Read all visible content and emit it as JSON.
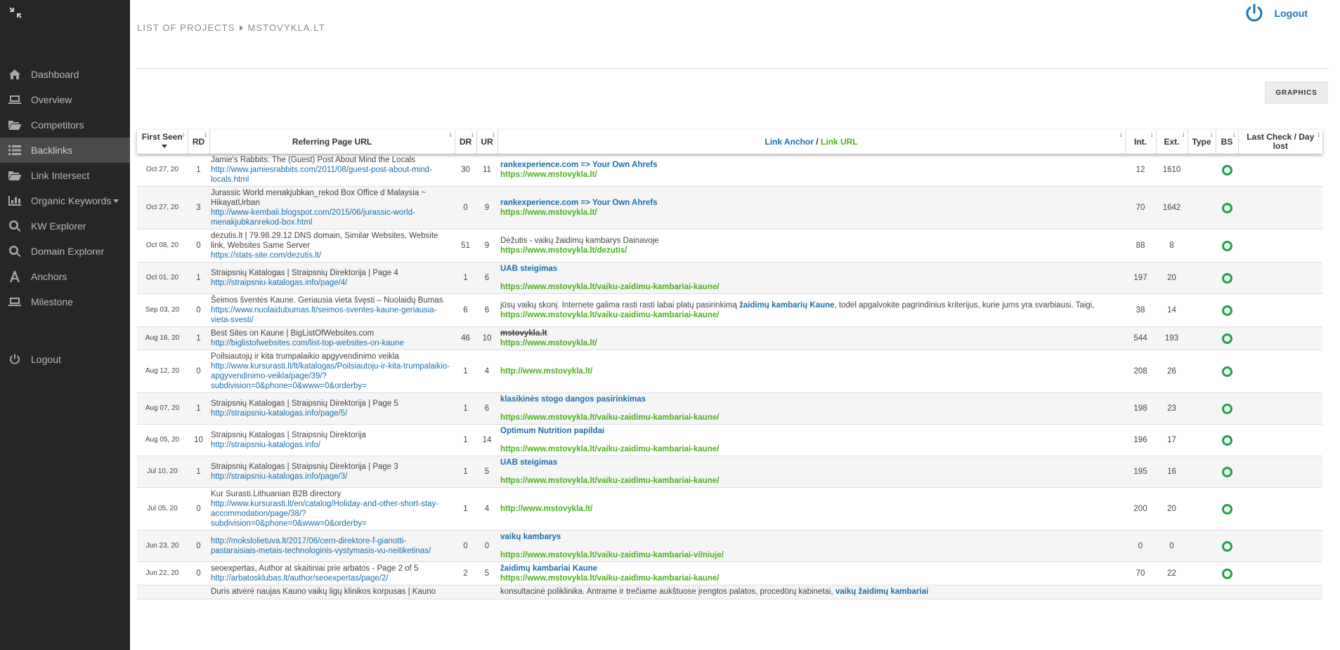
{
  "sidebar": {
    "items": [
      {
        "label": "Dashboard",
        "icon": "home-icon"
      },
      {
        "label": "Overview",
        "icon": "laptop-icon"
      },
      {
        "label": "Competitors",
        "icon": "folder-open-icon"
      },
      {
        "label": "Backlinks",
        "icon": "list-icon",
        "active": true
      },
      {
        "label": "Link Intersect",
        "icon": "folder-open-icon"
      },
      {
        "label": "Organic Keywords",
        "icon": "bar-chart-icon",
        "dropdown": true
      },
      {
        "label": "KW Explorer",
        "icon": "search-icon"
      },
      {
        "label": "Domain Explorer",
        "icon": "search-icon"
      },
      {
        "label": "Anchors",
        "icon": "font-icon"
      },
      {
        "label": "Milestone",
        "icon": "laptop-icon"
      }
    ],
    "logout_label": "Logout"
  },
  "header": {
    "breadcrumb_root": "LIST OF PROJECTS",
    "breadcrumb_current": "MSTOVYKLA.LT",
    "logout_label": "Logout",
    "graphics_label": "GRAPHICS"
  },
  "table": {
    "headers": {
      "first_seen": "First Seen",
      "rd": "RD",
      "ref_url": "Referring Page URL",
      "dr": "DR",
      "ur": "UR",
      "anchor": "Link Anchor",
      "slash": " / ",
      "link_url": "Link URL",
      "int": "Int.",
      "ext": "Ext.",
      "type": "Type",
      "bs": "BS",
      "last_check": "Last Check / Day lost",
      "info": "i"
    },
    "rows": [
      {
        "date": "Oct 27, 20",
        "rd": "1",
        "title": "Jamie's Rabbits: The (Guest) Post About Mind the Locals",
        "url": "http://www.jamiesrabbits.com/2011/08/guest-post-about-mind-locals.html",
        "dr": "30",
        "ur": "11",
        "anchor": "rankexperience.com => Your Own Ahrefs",
        "pre": "",
        "post": "",
        "strike": false,
        "gap": false,
        "link": "https://www.mstovykla.lt/",
        "int": "12",
        "ext": "1610"
      },
      {
        "date": "Oct 27, 20",
        "rd": "3",
        "title": "Jurassic World menakjubkan_rekod Box Office d Malaysia ~ HikayatUrban",
        "url": "http://www-kembali.blogspot.com/2015/06/jurassic-world-menakjubkanrekod-box.html",
        "dr": "0",
        "ur": "9",
        "anchor": "rankexperience.com => Your Own Ahrefs",
        "pre": "",
        "post": "",
        "strike": false,
        "gap": false,
        "link": "https://www.mstovykla.lt/",
        "int": "70",
        "ext": "1642"
      },
      {
        "date": "Oct 08, 20",
        "rd": "0",
        "title": "dezutis.lt | 79.98.29.12 DNS domain, Similar Websites, Website link, Websites Same Server",
        "url": "https://stats-site.com/dezutis.lt/",
        "dr": "51",
        "ur": "9",
        "anchor": "",
        "pre": "Dėžutis - vaikų žaidimų kambarys Dainavoje",
        "post": "",
        "strike": false,
        "gap": false,
        "link": "https://www.mstovykla.lt/dezutis/",
        "int": "88",
        "ext": "8"
      },
      {
        "date": "Oct 01, 20",
        "rd": "1",
        "title": "Straipsnių Katalogas | Straipsnių Direktorija | Page 4",
        "url": "http://straipsniu-katalogas.info/page/4/",
        "dr": "1",
        "ur": "6",
        "anchor": "UAB steigimas",
        "pre": "",
        "post": "",
        "strike": false,
        "gap": true,
        "link": "https://www.mstovykla.lt/vaiku-zaidimu-kambariai-kaune/",
        "int": "197",
        "ext": "20"
      },
      {
        "date": "Sep 03, 20",
        "rd": "0",
        "title": "Šeimos šventės Kaune. Geriausia vieta švęsti – Nuolaidų Bumas",
        "url": "https://www.nuolaidubumas.lt/seimos-sventes-kaune-geriausia-vieta-svesti/",
        "dr": "6",
        "ur": "6",
        "anchor": "žaidimų kambarių Kaune",
        "pre": "jūsų vaikų skonį. Internete galima rasti rasti labai platų pasirinkimą ",
        "post": ", todėl apgalvokite pagrindinius kriterijus, kurie jums yra svarbiausi. Taigi,",
        "strike": false,
        "gap": false,
        "link": "https://www.mstovykla.lt/vaiku-zaidimu-kambariai-kaune/",
        "int": "38",
        "ext": "14"
      },
      {
        "date": "Aug 16, 20",
        "rd": "1",
        "title": "Best Sites on Kaune | BigListOfWebsites.com",
        "url": "http://biglistofwebsites.com/list-top-websites-on-kaune",
        "dr": "46",
        "ur": "10",
        "anchor": "mstovykla.lt",
        "pre": "",
        "post": "",
        "strike": true,
        "gap": false,
        "link": "https://www.mstovykla.lt/",
        "int": "544",
        "ext": "193"
      },
      {
        "date": "Aug 12, 20",
        "rd": "0",
        "title": "Poilsiautojų ir kita trumpalaikio apgyvendinimo veikla",
        "url": "http://www.kursurasti.lt/lt/katalogas/Poilsiautoju-ir-kita-trumpalaikio-apgyvendinimo-veikla/page/39/?subdivision=0&phone=0&www=0&orderby=",
        "dr": "1",
        "ur": "4",
        "anchor": "",
        "pre": "",
        "post": "",
        "strike": false,
        "gap": false,
        "link": "http://www.mstovykla.lt/",
        "int": "208",
        "ext": "26"
      },
      {
        "date": "Aug 07, 20",
        "rd": "1",
        "title": "Straipsnių Katalogas | Straipsnių Direktorija | Page 5",
        "url": "http://straipsniu-katalogas.info/page/5/",
        "dr": "1",
        "ur": "6",
        "anchor": "klasikinės stogo dangos pasirinkimas",
        "pre": "",
        "post": "",
        "strike": false,
        "gap": true,
        "link": "https://www.mstovykla.lt/vaiku-zaidimu-kambariai-kaune/",
        "int": "198",
        "ext": "23"
      },
      {
        "date": "Aug 05, 20",
        "rd": "10",
        "title": "Straipsnių Katalogas | Straipsnių Direktorija",
        "url": "http://straipsniu-katalogas.info/",
        "dr": "1",
        "ur": "14",
        "anchor": "Optimum Nutrition papildai",
        "pre": "",
        "post": "",
        "strike": false,
        "gap": true,
        "link": "https://www.mstovykla.lt/vaiku-zaidimu-kambariai-kaune/",
        "int": "196",
        "ext": "17"
      },
      {
        "date": "Jul 10, 20",
        "rd": "1",
        "title": "Straipsnių Katalogas | Straipsnių Direktorija | Page 3",
        "url": "http://straipsniu-katalogas.info/page/3/",
        "dr": "1",
        "ur": "5",
        "anchor": "UAB steigimas",
        "pre": "",
        "post": "",
        "strike": false,
        "gap": true,
        "link": "https://www.mstovykla.lt/vaiku-zaidimu-kambariai-kaune/",
        "int": "195",
        "ext": "16"
      },
      {
        "date": "Jul 05, 20",
        "rd": "0",
        "title": "Kur Surasti.Lithuanian B2B directory",
        "url": "http://www.kursurasti.lt/en/catalog/Holiday-and-other-short-stay-accommodation/page/38/?subdivision=0&phone=0&www=0&orderby=",
        "dr": "1",
        "ur": "4",
        "anchor": "",
        "pre": "",
        "post": "",
        "strike": false,
        "gap": false,
        "link": "http://www.mstovykla.lt/",
        "int": "200",
        "ext": "20"
      },
      {
        "date": "Jun 23, 20",
        "rd": "0",
        "title": "",
        "url": "http://mokslolietuva.lt/2017/06/cern-direktore-f-gianotti-pastaraisiais-metais-technologinis-vystymasis-vu-neitiketinas/",
        "dr": "0",
        "ur": "0",
        "anchor": "vaikų kambarys",
        "pre": "",
        "post": "",
        "strike": false,
        "gap": true,
        "link": "https://www.mstovykla.lt/vaiku-zaidimu-kambariai-vilniuje/",
        "int": "0",
        "ext": "0"
      },
      {
        "date": "Jun 22, 20",
        "rd": "0",
        "title": "seoexpertas, Author at skaitiniai prie arbatos - Page 2 of 5",
        "url": "http://arbatosklubas.lt/author/seoexpertas/page/2/",
        "dr": "2",
        "ur": "5",
        "anchor": "žaidimų kambariai Kaune",
        "pre": "",
        "post": "",
        "strike": false,
        "gap": false,
        "link": "https://www.mstovykla.lt/vaiku-zaidimu-kambariai-kaune/",
        "int": "70",
        "ext": "22"
      },
      {
        "date": "",
        "rd": "",
        "title": "Duris atvėrė naujas Kauno vaikų ligų klinikos korpusas | Kauno",
        "url": "",
        "dr": "",
        "ur": "",
        "anchor": "vaikų žaidimų kambariai",
        "pre": "konsultacinė poliklinika. Antrame ir trečiame aukštuose įrengtos palatos, procedūrų kabinetai, ",
        "post": "",
        "strike": false,
        "gap": false,
        "link": "",
        "int": "",
        "ext": ""
      }
    ]
  }
}
